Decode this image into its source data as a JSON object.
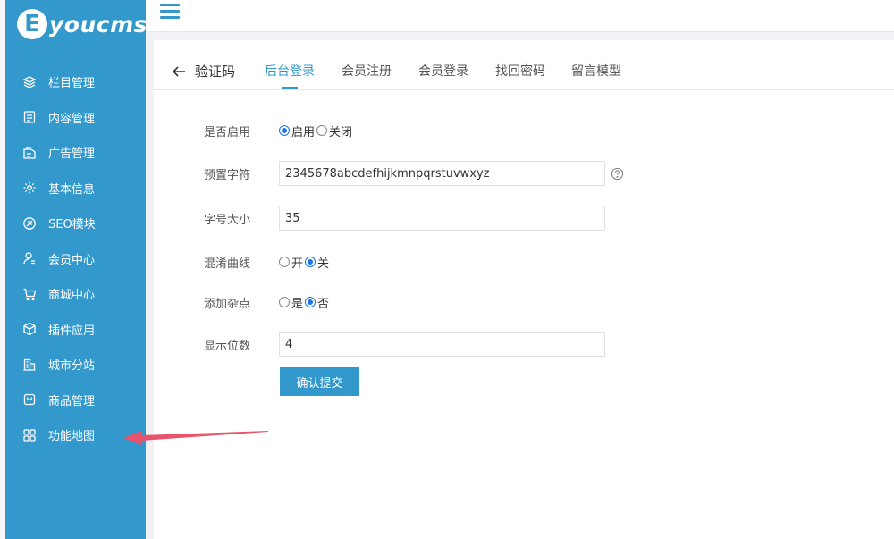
{
  "logo": {
    "mark": "E",
    "text": "youcms"
  },
  "sidebar": {
    "items": [
      {
        "label": "栏目管理",
        "icon": "layers-icon"
      },
      {
        "label": "内容管理",
        "icon": "document-icon"
      },
      {
        "label": "广告管理",
        "icon": "ad-icon"
      },
      {
        "label": "基本信息",
        "icon": "gear-icon"
      },
      {
        "label": "SEO模块",
        "icon": "seo-icon"
      },
      {
        "label": "会员中心",
        "icon": "user-icon"
      },
      {
        "label": "商城中心",
        "icon": "cart-icon"
      },
      {
        "label": "插件应用",
        "icon": "cube-icon"
      },
      {
        "label": "城市分站",
        "icon": "building-icon"
      },
      {
        "label": "商品管理",
        "icon": "bag-icon"
      },
      {
        "label": "功能地图",
        "icon": "grid-icon"
      }
    ]
  },
  "tabs": {
    "back_label": "验证码",
    "items": [
      {
        "label": "后台登录",
        "active": true
      },
      {
        "label": "会员注册",
        "active": false
      },
      {
        "label": "会员登录",
        "active": false
      },
      {
        "label": "找回密码",
        "active": false
      },
      {
        "label": "留言模型",
        "active": false
      }
    ]
  },
  "form": {
    "enable": {
      "label": "是否启用",
      "options": [
        "启用",
        "关闭"
      ],
      "selected": "启用"
    },
    "charset": {
      "label": "预置字符",
      "value": "2345678abcdefhijkmnpqrstuvwxyz"
    },
    "font_size": {
      "label": "字号大小",
      "value": "35"
    },
    "curve": {
      "label": "混淆曲线",
      "options": [
        "开",
        "关"
      ],
      "selected": "关"
    },
    "noise": {
      "label": "添加杂点",
      "options": [
        "是",
        "否"
      ],
      "selected": "否"
    },
    "length": {
      "label": "显示位数",
      "value": "4"
    },
    "submit_label": "确认提交"
  },
  "colors": {
    "sidebar": "#3398cc",
    "accent": "#3398cc",
    "radio": "#1a73e8",
    "arrow": "#e8546b"
  }
}
